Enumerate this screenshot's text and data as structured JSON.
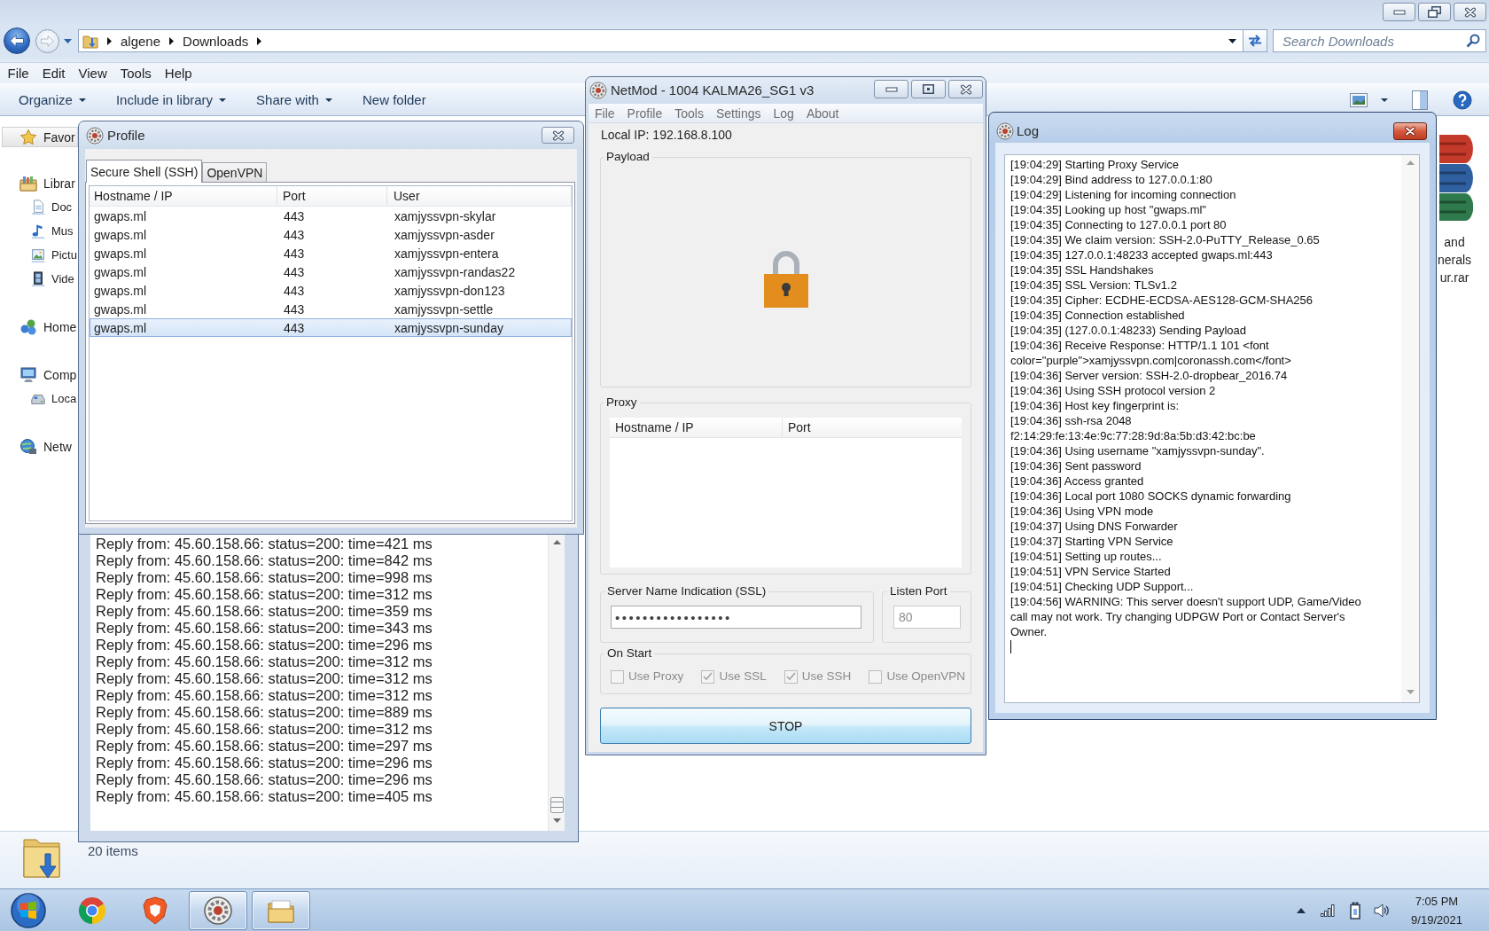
{
  "explorer": {
    "navigation": {
      "back": {
        "disabled": false
      },
      "forward": {
        "disabled": true
      }
    },
    "breadcrumbs": [
      "algene",
      "Downloads"
    ],
    "search": {
      "placeholder": "Search Downloads"
    },
    "menu": [
      "File",
      "Edit",
      "View",
      "Tools",
      "Help"
    ],
    "commands": [
      {
        "label": "Organize",
        "dropdown": true
      },
      {
        "label": "Include in library",
        "dropdown": true
      },
      {
        "label": "Share with",
        "dropdown": true
      },
      {
        "label": "New folder",
        "dropdown": false
      }
    ],
    "sidebar": [
      {
        "label": "Favor",
        "selected": true
      },
      {
        "label": "Librar",
        "selected": false,
        "children": [
          {
            "label": "Doc",
            "selected": false
          },
          {
            "label": "Mus",
            "selected": false
          },
          {
            "label": "Pictu",
            "selected": false
          },
          {
            "label": "Vide",
            "selected": false
          }
        ]
      },
      {
        "label": "Home",
        "selected": false
      },
      {
        "label": "Comp",
        "selected": false,
        "children": [
          {
            "label": "Loca",
            "selected": false
          }
        ]
      },
      {
        "label": "Netw",
        "selected": false
      }
    ],
    "file_name_fragments": [
      "and",
      "nerals",
      "ur.rar"
    ],
    "status": "20 items"
  },
  "profile_window": {
    "title": "Profile",
    "active": false,
    "tabs": [
      {
        "label": "Secure Shell (SSH)",
        "selected": true
      },
      {
        "label": "OpenVPN",
        "selected": false
      }
    ],
    "table": {
      "columns": [
        "Hostname / IP",
        "Port",
        "User"
      ],
      "rows": [
        {
          "cells": [
            "gwaps.ml",
            "443",
            "xamjyssvpn-skylar"
          ],
          "selected": false
        },
        {
          "cells": [
            "gwaps.ml",
            "443",
            "xamjyssvpn-asder"
          ],
          "selected": false
        },
        {
          "cells": [
            "gwaps.ml",
            "443",
            "xamjyssvpn-entera"
          ],
          "selected": false
        },
        {
          "cells": [
            "gwaps.ml",
            "443",
            "xamjyssvpn-randas22"
          ],
          "selected": false
        },
        {
          "cells": [
            "gwaps.ml",
            "443",
            "xamjyssvpn-don123"
          ],
          "selected": false
        },
        {
          "cells": [
            "gwaps.ml",
            "443",
            "xamjyssvpn-settle"
          ],
          "selected": false
        },
        {
          "cells": [
            "gwaps.ml",
            "443",
            "xamjyssvpn-sunday"
          ],
          "selected": true
        }
      ]
    }
  },
  "ping_window": {
    "lines": [
      "Reply from: 45.60.158.66: status=200: time=421 ms",
      "Reply from: 45.60.158.66: status=200: time=842 ms",
      "Reply from: 45.60.158.66: status=200: time=998 ms",
      "Reply from: 45.60.158.66: status=200: time=312 ms",
      "Reply from: 45.60.158.66: status=200: time=359 ms",
      "Reply from: 45.60.158.66: status=200: time=343 ms",
      "Reply from: 45.60.158.66: status=200: time=296 ms",
      "Reply from: 45.60.158.66: status=200: time=312 ms",
      "Reply from: 45.60.158.66: status=200: time=312 ms",
      "Reply from: 45.60.158.66: status=200: time=312 ms",
      "Reply from: 45.60.158.66: status=200: time=889 ms",
      "Reply from: 45.60.158.66: status=200: time=312 ms",
      "Reply from: 45.60.158.66: status=200: time=297 ms",
      "Reply from: 45.60.158.66: status=200: time=296 ms",
      "Reply from: 45.60.158.66: status=200: time=296 ms",
      "Reply from: 45.60.158.66: status=200: time=405 ms"
    ]
  },
  "netmod_window": {
    "title": "NetMod - 1004 KALMA26_SG1 v3",
    "active": false,
    "menu": [
      "File",
      "Profile",
      "Tools",
      "Settings",
      "Log",
      "About"
    ],
    "local_ip": "Local IP: 192.168.8.100",
    "payload": {
      "label": "Payload"
    },
    "proxy": {
      "label": "Proxy",
      "columns": [
        "Hostname / IP",
        "Port"
      ]
    },
    "sni": {
      "label": "Server Name Indication (SSL)",
      "value": "•••••••••••••••••"
    },
    "listen_port": {
      "label": "Listen Port",
      "value": "80",
      "disabled": true
    },
    "on_start": {
      "label": "On Start",
      "options": [
        {
          "label": "Use Proxy",
          "checked": false,
          "disabled": true
        },
        {
          "label": "Use SSL",
          "checked": true,
          "disabled": true
        },
        {
          "label": "Use SSH",
          "checked": true,
          "disabled": true
        },
        {
          "label": "Use OpenVPN",
          "checked": false,
          "disabled": true
        }
      ]
    },
    "button": "STOP"
  },
  "log_window": {
    "title": "Log",
    "active": true,
    "lines": [
      "[19:04:29] Starting Proxy Service",
      "[19:04:29] Bind address to 127.0.0.1:80",
      "[19:04:29] Listening for incoming connection",
      "[19:04:35] Looking up host \"gwaps.ml\"",
      "[19:04:35] Connecting to 127.0.0.1 port 80",
      "[19:04:35] We claim version: SSH-2.0-PuTTY_Release_0.65",
      "[19:04:35] 127.0.0.1:48233 accepted gwaps.ml:443",
      "[19:04:35] SSL Handshakes",
      "[19:04:35] SSL Version: TLSv1.2",
      "[19:04:35] Cipher: ECDHE-ECDSA-AES128-GCM-SHA256",
      "[19:04:35] Connection established",
      "[19:04:35] (127.0.0.1:48233) Sending Payload",
      "[19:04:36] Receive Response: HTTP/1.1 101 <font color=\"purple\">xamjyssvpn.com|coronassh.com</font>",
      "[19:04:36] Server version: SSH-2.0-dropbear_2016.74",
      "[19:04:36] Using SSH protocol version 2",
      "[19:04:36] Host key fingerprint is:",
      "[19:04:36] ssh-rsa 2048 f2:14:29:fe:13:4e:9c:77:28:9d:8a:5b:d3:42:bc:be",
      "[19:04:36] Using username \"xamjyssvpn-sunday\".",
      "[19:04:36] Sent password",
      "[19:04:36] Access granted",
      "[19:04:36] Local port 1080 SOCKS dynamic forwarding",
      "[19:04:36] Using VPN mode",
      "[19:04:37] Using DNS Forwarder",
      "[19:04:37] Starting VPN Service",
      "[19:04:51] Setting up routes...",
      "[19:04:51] VPN Service Started",
      "[19:04:51] Checking UDP Support...",
      "[19:04:56] WARNING: This server doesn't support UDP, Game/Video call may not work. Try changing UDPGW Port or Contact Server's Owner."
    ]
  },
  "taskbar": {
    "apps": [
      {
        "open": false
      },
      {
        "open": false
      },
      {
        "open": true
      },
      {
        "open": true
      }
    ],
    "clock": {
      "time": "7:05 PM",
      "date": "9/19/2021"
    }
  }
}
